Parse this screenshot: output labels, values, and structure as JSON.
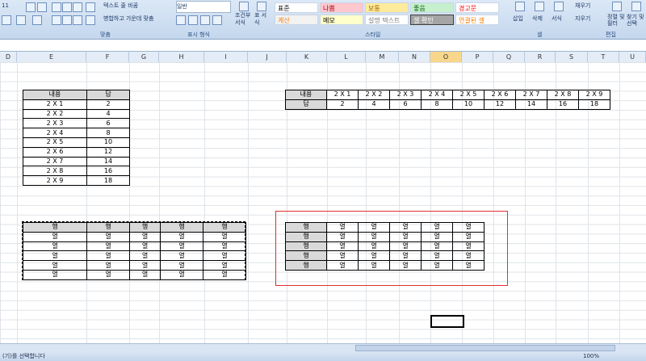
{
  "ribbon": {
    "font_size": "11",
    "wrap_text": "텍스트 줄 바꿈",
    "merge_center": "병합하고 가운데 맞춤",
    "number_format": "일반",
    "cond_format": "조건부 서식",
    "table_format": "표 서식",
    "styles": [
      {
        "label": "표준",
        "bg": "#ffffff",
        "fg": "#000000"
      },
      {
        "label": "나쁨",
        "bg": "#ffc7ce",
        "fg": "#9c0006"
      },
      {
        "label": "보통",
        "bg": "#ffeb9c",
        "fg": "#9c6500"
      },
      {
        "label": "좋음",
        "bg": "#c6efce",
        "fg": "#006100"
      },
      {
        "label": "경고문",
        "bg": "#ffffff",
        "fg": "#ff0000"
      },
      {
        "label": "계산",
        "bg": "#f2f2f2",
        "fg": "#fa7d00"
      },
      {
        "label": "메모",
        "bg": "#ffffcc",
        "fg": "#000000"
      },
      {
        "label": "설명 텍스트",
        "bg": "#ffffff",
        "fg": "#7f7f7f"
      },
      {
        "label": "셀 확인",
        "bg": "#a5a5a5",
        "fg": "#ffffff"
      },
      {
        "label": "연결된 셀",
        "bg": "#ffffff",
        "fg": "#fa7d00"
      }
    ],
    "insert": "삽입",
    "delete": "삭제",
    "format": "서식",
    "fill": "채우기",
    "clear": "지우기",
    "sort_filter": "정렬 및 필터",
    "find_select": "찾기 및 선택",
    "groups": {
      "alignment": "맞춤",
      "number": "표시 형식",
      "styles": "스타일",
      "cells": "셀",
      "editing": "편집"
    }
  },
  "columns": [
    "D",
    "E",
    "F",
    "G",
    "H",
    "I",
    "J",
    "K",
    "L",
    "M",
    "N",
    "O",
    "P",
    "Q",
    "R",
    "S",
    "T",
    "U"
  ],
  "active_column": "O",
  "table1": {
    "header": [
      "내용",
      "답"
    ],
    "rows": [
      [
        "2 X 1",
        "2"
      ],
      [
        "2 X 2",
        "4"
      ],
      [
        "2 X 3",
        "6"
      ],
      [
        "2 X 4",
        "8"
      ],
      [
        "2 X 5",
        "10"
      ],
      [
        "2 X 6",
        "12"
      ],
      [
        "2 X 7",
        "14"
      ],
      [
        "2 X 8",
        "16"
      ],
      [
        "2 X 9",
        "18"
      ]
    ]
  },
  "table2": {
    "row_labels": [
      "내용",
      "답"
    ],
    "items": [
      "2 X 1",
      "2 X 2",
      "2 X 3",
      "2 X 4",
      "2 X 5",
      "2 X 6",
      "2 X 7",
      "2 X 8",
      "2 X 9"
    ],
    "answers": [
      "2",
      "4",
      "6",
      "8",
      "10",
      "12",
      "14",
      "16",
      "18"
    ]
  },
  "table3": {
    "header": [
      "행",
      "행",
      "행",
      "행",
      "행"
    ],
    "rows": [
      [
        "열",
        "열",
        "열",
        "열",
        "열"
      ],
      [
        "열",
        "열",
        "열",
        "열",
        "열"
      ],
      [
        "열",
        "열",
        "열",
        "열",
        "열"
      ],
      [
        "열",
        "열",
        "열",
        "열",
        "열"
      ],
      [
        "열",
        "열",
        "열",
        "열",
        "열"
      ]
    ]
  },
  "table4": {
    "row_labels": [
      "행",
      "행",
      "행",
      "행",
      "행"
    ],
    "cols": [
      "열",
      "열",
      "열",
      "열",
      "열"
    ]
  },
  "status": {
    "text": "(기)를 선택합니다",
    "zoom": "100%"
  }
}
